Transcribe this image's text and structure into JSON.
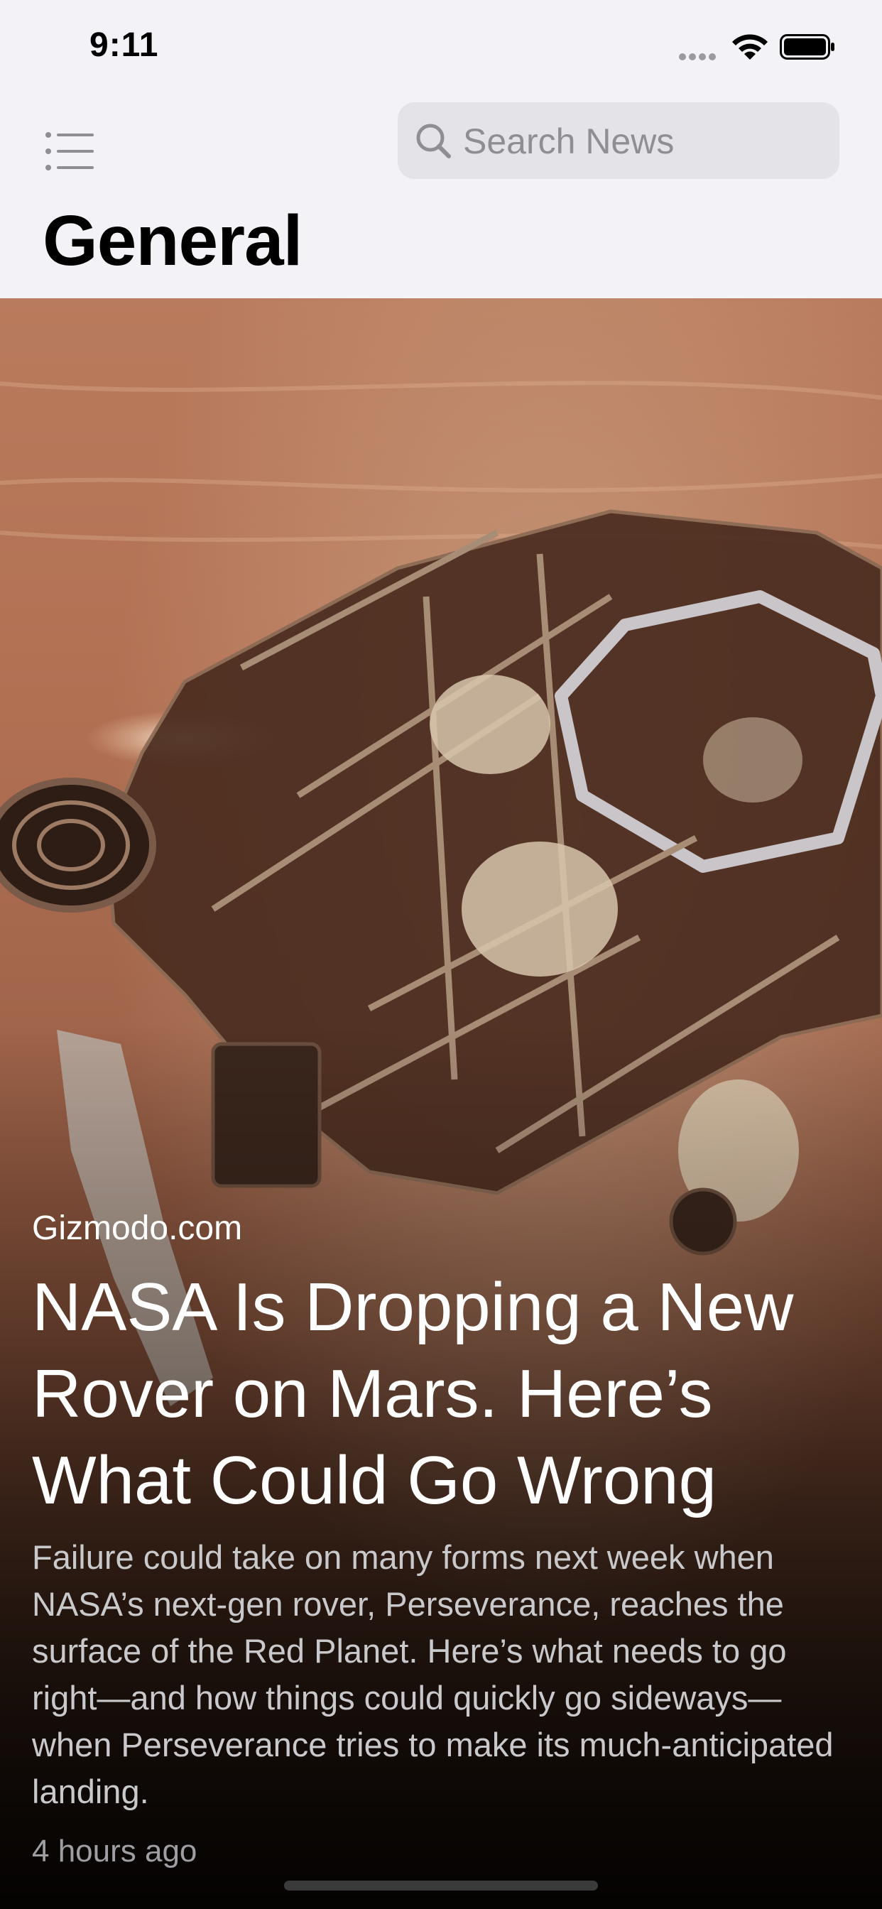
{
  "status_bar": {
    "time": "9:11",
    "signal_icon": "cellular-dots-icon",
    "wifi_icon": "wifi-icon",
    "battery_icon": "battery-full-icon"
  },
  "nav": {
    "menu_icon": "list-icon",
    "search": {
      "placeholder": "Search News",
      "value": "",
      "icon": "search-icon"
    },
    "title": "General"
  },
  "article": {
    "source": "Gizmodo.com",
    "headline": "NASA Is Dropping a New Rover on Mars. Here’s What Could Go Wrong",
    "summary": "Failure could take on many forms next week when NASA’s next-gen rover, Perseverance, reaches the surface of the Red Planet. Here’s what needs to go right—and how things could quickly go sideways—when Perseverance tries to make its much-anticipated landing.",
    "time_ago": "4 hours ago",
    "image": "mars-rover-image"
  },
  "colors": {
    "background": "#f2f2f7",
    "search_field": "#e3e3e8",
    "headline_text": "#ffffff",
    "summary_text": "#c9c9cc"
  }
}
